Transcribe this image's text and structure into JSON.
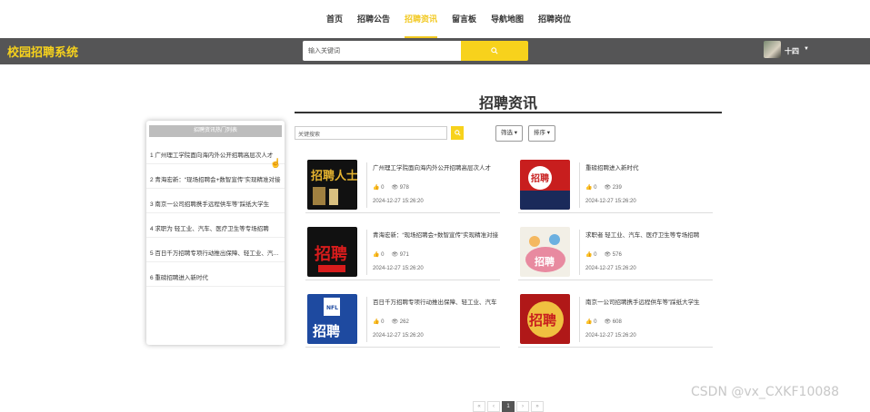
{
  "nav": {
    "items": [
      "首页",
      "招聘公告",
      "招聘资讯",
      "留言板",
      "导航地图",
      "招聘岗位"
    ],
    "active": "招聘资讯"
  },
  "header": {
    "brand": "校园招聘系统",
    "search_placeholder": "输入关键词",
    "username": "十四"
  },
  "main": {
    "title": "招聘资讯",
    "filter_placeholder": "关键搜索",
    "filter_btn": "筛选",
    "sort_btn": "排序"
  },
  "sidebar": {
    "heading": "招聘资讯热门列表",
    "items": [
      "1 广州理工学院面向海内外公开招聘高层次人才",
      "2 青海宏新：“现场招聘会+数智宣传”实现精准对接",
      "3 南京一公司招聘携手远程供车等”踩纸大学生",
      "4 求职为 轻工业、汽车、医疗卫生等专场招聘",
      "5 百日千万招聘专项行动推出保障、轻工业、汽车等",
      "6 重磅招聘进入新时代"
    ]
  },
  "cards": [
    {
      "title": "广州理工学院面向海内外公开招聘高层次人才",
      "likes": "0",
      "views": "978",
      "date": "2024-12-27 15:26:20",
      "thumb": "招聘人士"
    },
    {
      "title": "重磅招聘进入新时代",
      "likes": "0",
      "views": "239",
      "date": "2024-12-27 15:26:20",
      "thumb": "招聘"
    },
    {
      "title": "青海宏新：“现场招聘会+数智宣传”实现精准对接",
      "likes": "0",
      "views": "971",
      "date": "2024-12-27 15:26:20",
      "thumb": "招聘"
    },
    {
      "title": "求职者 轻工业、汽车、医疗卫生等专场招聘",
      "likes": "0",
      "views": "576",
      "date": "2024-12-27 15:26:20",
      "thumb": "招聘"
    },
    {
      "title": "百日千万招聘专项行动推出保障、轻工业、汽车",
      "likes": "0",
      "views": "262",
      "date": "2024-12-27 15:26:20",
      "thumb": "招聘"
    },
    {
      "title": "南京一公司招聘携手远程供车等”踩纸大学生",
      "likes": "0",
      "views": "608",
      "date": "2024-12-27 15:26:20",
      "thumb": "招聘"
    }
  ],
  "pager": {
    "prev2": "«",
    "prev": "‹",
    "current": "1",
    "next": "›",
    "next2": "»"
  },
  "watermark": "CSDN @vx_CXKF10088",
  "colors": {
    "accent": "#f7d21c",
    "header_bg": "#555556"
  }
}
